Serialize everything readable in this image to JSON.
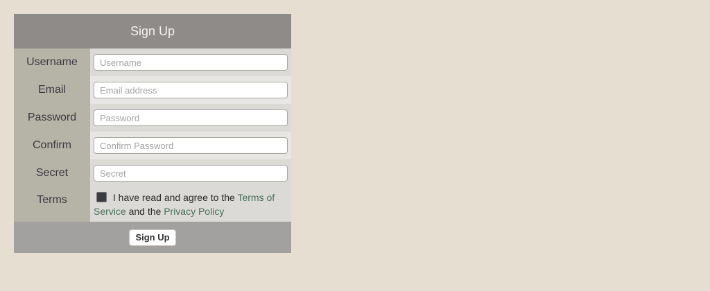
{
  "form": {
    "title": "Sign Up",
    "fields": [
      {
        "label": "Username",
        "placeholder": "Username",
        "value": ""
      },
      {
        "label": "Email",
        "placeholder": "Email address",
        "value": ""
      },
      {
        "label": "Password",
        "placeholder": "Password",
        "value": ""
      },
      {
        "label": "Confirm",
        "placeholder": "Confirm Password",
        "value": ""
      },
      {
        "label": "Secret",
        "placeholder": "Secret",
        "value": ""
      }
    ],
    "terms": {
      "label": "Terms",
      "text_before": " I have read and agree to the ",
      "tos_link": "Terms of Service",
      "text_middle": " and the ",
      "privacy_link": "Privacy Policy"
    },
    "submit_label": "Sign Up"
  }
}
